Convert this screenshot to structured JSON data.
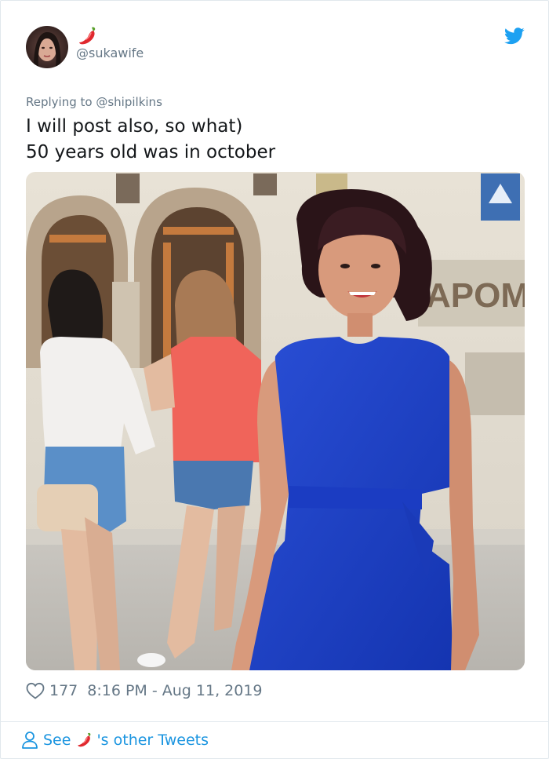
{
  "author": {
    "display_name_icon": "chili-pepper-icon",
    "handle": "@sukawife",
    "avatar_icon": "profile-avatar"
  },
  "brand": {
    "icon": "twitter-bird-icon",
    "color": "#1da1f2"
  },
  "reply": {
    "prefix": "Replying to",
    "target": "@shipilkins"
  },
  "tweet": {
    "lines": [
      "I will post also, so what)",
      "50 years old was in october"
    ]
  },
  "media": {
    "description_icon": "photo"
  },
  "meta": {
    "like_icon": "heart-icon",
    "likes": "177",
    "timestamp": "8:16 PM - Aug 11, 2019"
  },
  "footer": {
    "see_label": "See",
    "others_label": "'s other Tweets",
    "link_color": "#1b95e0"
  },
  "colors": {
    "muted": "#657786",
    "text": "#14171a",
    "border": "#e1e8ed"
  }
}
